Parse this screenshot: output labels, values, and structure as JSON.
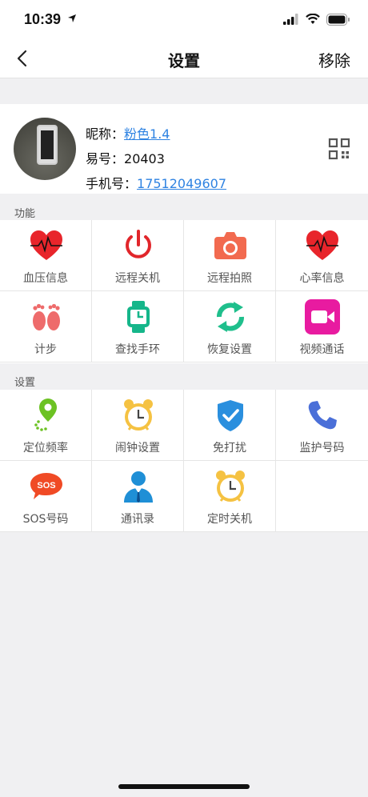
{
  "status": {
    "time": "10:39"
  },
  "nav": {
    "title": "设置",
    "right": "移除"
  },
  "profile": {
    "nickname_label": "昵称：",
    "nickname": "粉色1.4",
    "yihao_label": "易号：",
    "yihao": "20403",
    "phone_label": "手机号：",
    "phone": "17512049607"
  },
  "functions": {
    "label": "功能",
    "items": [
      {
        "label": "血压信息",
        "icon": "heart-pulse-icon"
      },
      {
        "label": "远程关机",
        "icon": "power-icon"
      },
      {
        "label": "远程拍照",
        "icon": "camera-icon"
      },
      {
        "label": "心率信息",
        "icon": "heart-rate-icon"
      },
      {
        "label": "计步",
        "icon": "footprints-icon"
      },
      {
        "label": "查找手环",
        "icon": "watch-icon"
      },
      {
        "label": "恢复设置",
        "icon": "refresh-icon"
      },
      {
        "label": "视频通话",
        "icon": "video-call-icon"
      }
    ]
  },
  "settings": {
    "label": "设置",
    "items": [
      {
        "label": "定位频率",
        "icon": "location-pin-icon"
      },
      {
        "label": "闹钟设置",
        "icon": "alarm-clock-icon"
      },
      {
        "label": "免打扰",
        "icon": "shield-check-icon"
      },
      {
        "label": "监护号码",
        "icon": "phone-icon"
      },
      {
        "label": "SOS号码",
        "icon": "sos-icon"
      },
      {
        "label": "通讯录",
        "icon": "contacts-icon"
      },
      {
        "label": "定时关机",
        "icon": "timer-alarm-icon"
      }
    ]
  }
}
